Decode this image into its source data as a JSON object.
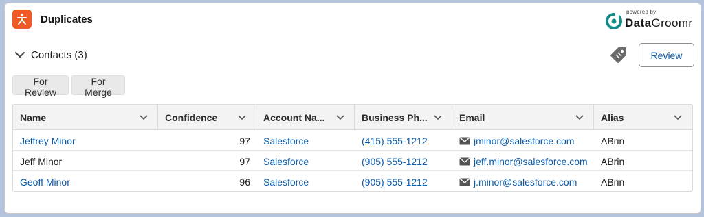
{
  "header": {
    "title": "Duplicates"
  },
  "brand": {
    "powered_by": "powered by",
    "name_bold": "Data",
    "name_rest": "Groomr"
  },
  "section": {
    "title": "Contacts (3)"
  },
  "actions": {
    "review_label": "Review"
  },
  "filters": [
    {
      "label": "For Review"
    },
    {
      "label": "For Merge"
    }
  ],
  "table": {
    "columns": [
      {
        "label": "Name"
      },
      {
        "label": "Confidence"
      },
      {
        "label": "Account Na..."
      },
      {
        "label": "Business Ph..."
      },
      {
        "label": "Email"
      },
      {
        "label": "Alias"
      }
    ],
    "rows": [
      {
        "name": "Jeffrey Minor",
        "name_link": true,
        "confidence": "97",
        "account": "Salesforce",
        "phone": "(415) 555-1212",
        "email": "jminor@salesforce.com",
        "alias": "ABrin"
      },
      {
        "name": "Jeff Minor",
        "name_link": false,
        "confidence": "97",
        "account": "Salesforce",
        "phone": "(905) 555-1212",
        "email": "jeff.minor@salesforce.com",
        "alias": "ABrin"
      },
      {
        "name": "Geoff Minor",
        "name_link": true,
        "confidence": "96",
        "account": "Salesforce",
        "phone": "(905) 555-1212",
        "email": "j.minor@salesforce.com",
        "alias": "ABrin"
      }
    ]
  },
  "colors": {
    "accent": "#f05a28",
    "link": "#0b5cab",
    "brand_teal": "#138a85",
    "icon_gray": "#6b6b6b"
  },
  "icons": {
    "app": "duplicate-app-icon",
    "section_toggle": "chevron-down-icon",
    "tag": "tag-icon",
    "column_menu": "chevron-down-icon",
    "email": "envelope-icon"
  }
}
